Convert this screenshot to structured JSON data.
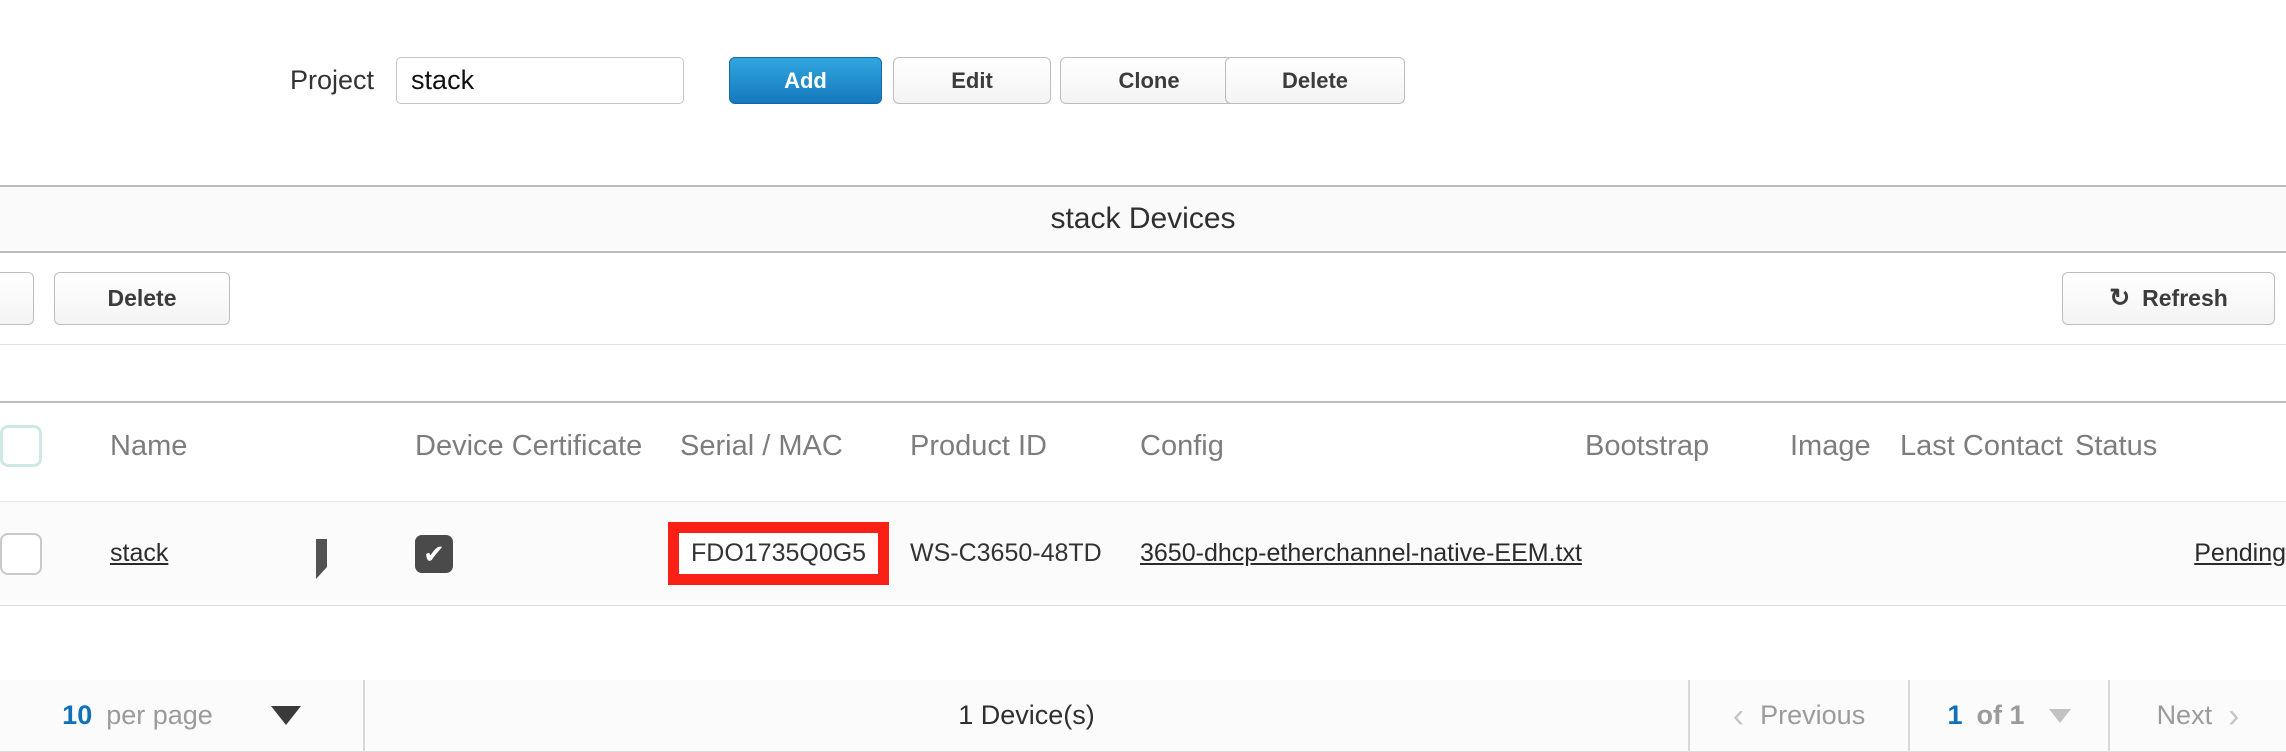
{
  "project_bar": {
    "label": "Project",
    "input_value": "stack",
    "input_placeholder": "",
    "buttons": [
      {
        "id": "add",
        "label": "Add"
      },
      {
        "id": "edit",
        "label": "Edit"
      },
      {
        "id": "clone",
        "label": "Clone"
      },
      {
        "id": "delete",
        "label": "Delete"
      }
    ]
  },
  "section": {
    "title": "stack Devices"
  },
  "action_bar": {
    "delete_label": "Delete",
    "refresh_label": "Refresh",
    "refresh_icon": "refresh-icon",
    "refresh_glyph": "↻"
  },
  "table": {
    "headers": [
      "",
      "Name",
      "",
      "Device Certificate",
      "Serial / MAC",
      "Product ID",
      "Config",
      "Bootstrap",
      "Image",
      "Last Contact",
      "Status"
    ],
    "header_checkbox_icon": "checkbox-unchecked-icon",
    "rows": [
      {
        "select_icon": "checkbox-unchecked-icon",
        "name": "stack",
        "stack_icon": "stack-layers-icon",
        "device_certificate_icon": "checkbox-checked-icon",
        "device_certificate_glyph": "✔",
        "serial_mac": "FDO1735Q0G5",
        "serial_highlighted": true,
        "highlight_color": "#fb2016",
        "product_id": "WS-C3650-48TD",
        "config": "3650-dhcp-etherchannel-native-EEM.txt",
        "bootstrap": "",
        "image": "",
        "last_contact": "",
        "status": "Pending"
      }
    ]
  },
  "footer": {
    "per_page_value": "10",
    "per_page_label": "per page",
    "per_page_caret_icon": "caret-down-icon",
    "device_count": "1 Device(s)",
    "previous_label": "Previous",
    "previous_icon": "chevron-left-icon",
    "previous_glyph": "‹",
    "page_current": "1",
    "page_of": "of 1",
    "page_caret_icon": "caret-down-icon",
    "next_label": "Next",
    "next_icon": "chevron-right-icon",
    "next_glyph": "›"
  },
  "colors": {
    "primary_button": "#1579bd",
    "accent_link": "#1071b8",
    "highlight_box": "#fb2016",
    "header_text": "#7d7d7d"
  }
}
